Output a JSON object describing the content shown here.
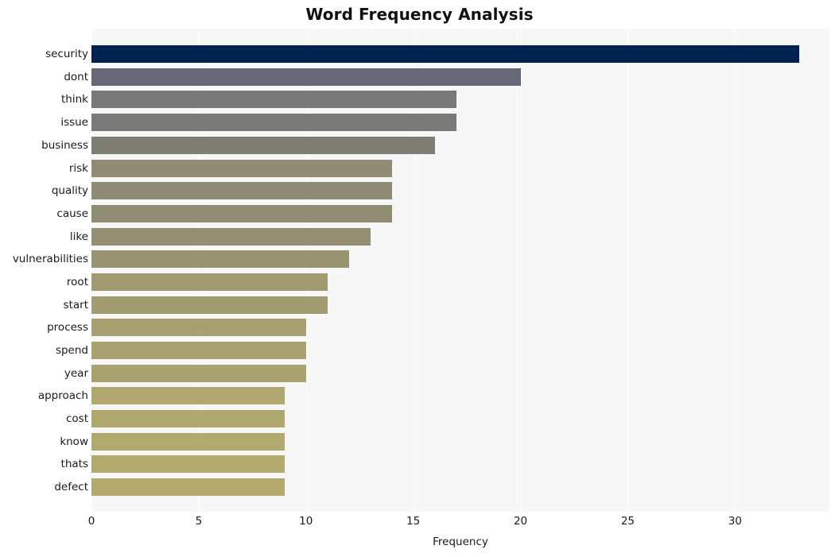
{
  "chart_data": {
    "type": "bar",
    "orientation": "horizontal",
    "title": "Word Frequency Analysis",
    "xlabel": "Frequency",
    "ylabel": "",
    "categories": [
      "security",
      "dont",
      "think",
      "issue",
      "business",
      "risk",
      "quality",
      "cause",
      "like",
      "vulnerabilities",
      "root",
      "start",
      "process",
      "spend",
      "year",
      "approach",
      "cost",
      "know",
      "thats",
      "defect"
    ],
    "values": [
      33,
      20,
      17,
      17,
      16,
      14,
      14,
      14,
      13,
      12,
      11,
      11,
      10,
      10,
      10,
      9,
      9,
      9,
      9,
      9
    ],
    "bar_colors": [
      "#00224e",
      "#666777",
      "#78787a",
      "#7a7a79",
      "#7f7e75",
      "#908b74",
      "#908b74",
      "#918c74",
      "#958f73",
      "#9a9372",
      "#a29a71",
      "#a39b71",
      "#a8a070",
      "#a9a170",
      "#a9a170",
      "#b1a86f",
      "#b1a86f",
      "#b2a96f",
      "#b3aa6f",
      "#b3aa6f"
    ],
    "xticks": [
      0,
      5,
      10,
      15,
      20,
      25,
      30
    ],
    "xtick_labels": [
      "0",
      "5",
      "10",
      "15",
      "20",
      "25",
      "30"
    ],
    "xlim": [
      0,
      34.4
    ],
    "grid": true,
    "grid_axis": "x",
    "legend": false,
    "colormap": "cividis",
    "plot_background": "#f7f7f7",
    "figure_background": "#ffffff",
    "title_color": "#111111",
    "tick_color": "#1a1a1a",
    "gridline_color": "#ffffff"
  }
}
